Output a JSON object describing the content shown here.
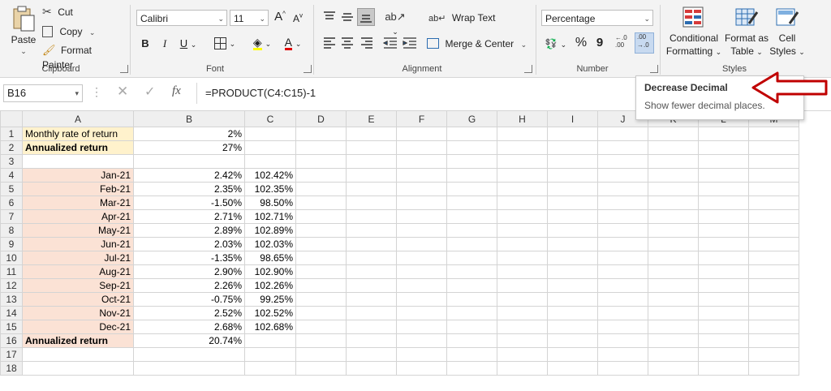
{
  "ribbon": {
    "clipboard": {
      "paste": "Paste",
      "cut": "Cut",
      "copy": "Copy",
      "format_painter": "Format Painter",
      "label": "Clipboard"
    },
    "font": {
      "name": "Calibri",
      "size": "11",
      "grow": "A",
      "shrink": "A",
      "bold": "B",
      "italic": "I",
      "underline": "U",
      "font_color": "A",
      "label": "Font"
    },
    "alignment": {
      "wrap_text": "Wrap Text",
      "merge_center": "Merge & Center",
      "label": "Alignment"
    },
    "number": {
      "format": "Percentage",
      "percent": "%",
      "comma": "9",
      "increase_decimal": "←.0 .00",
      "decrease_decimal": ".00 →.0",
      "label": "Number"
    },
    "styles": {
      "conditional": "Conditional",
      "formatting": "Formatting",
      "format_as": "Format as",
      "table": "Table",
      "cell": "Cell",
      "styles_word": "Styles",
      "label": "Styles"
    }
  },
  "formula_bar": {
    "name_box": "B16",
    "fx": "fx",
    "formula": "=PRODUCT(C4:C15)-1"
  },
  "tooltip": {
    "title": "Decrease Decimal",
    "body": "Show fewer decimal places."
  },
  "columns": [
    "A",
    "B",
    "C",
    "D",
    "E",
    "F",
    "G",
    "H",
    "I",
    "J",
    "K",
    "L",
    "M"
  ],
  "rows": [
    {
      "n": "1",
      "a": "Monthly rate of return",
      "b": "2%",
      "c": ""
    },
    {
      "n": "2",
      "a": "Annualized return",
      "b": "27%",
      "c": ""
    },
    {
      "n": "3",
      "a": "",
      "b": "",
      "c": ""
    },
    {
      "n": "4",
      "a": "Jan-21",
      "b": "2.42%",
      "c": "102.42%"
    },
    {
      "n": "5",
      "a": "Feb-21",
      "b": "2.35%",
      "c": "102.35%"
    },
    {
      "n": "6",
      "a": "Mar-21",
      "b": "-1.50%",
      "c": "98.50%"
    },
    {
      "n": "7",
      "a": "Apr-21",
      "b": "2.71%",
      "c": "102.71%"
    },
    {
      "n": "8",
      "a": "May-21",
      "b": "2.89%",
      "c": "102.89%"
    },
    {
      "n": "9",
      "a": "Jun-21",
      "b": "2.03%",
      "c": "102.03%"
    },
    {
      "n": "10",
      "a": "Jul-21",
      "b": "-1.35%",
      "c": "98.65%"
    },
    {
      "n": "11",
      "a": "Aug-21",
      "b": "2.90%",
      "c": "102.90%"
    },
    {
      "n": "12",
      "a": "Sep-21",
      "b": "2.26%",
      "c": "102.26%"
    },
    {
      "n": "13",
      "a": "Oct-21",
      "b": "-0.75%",
      "c": "99.25%"
    },
    {
      "n": "14",
      "a": "Nov-21",
      "b": "2.52%",
      "c": "102.52%"
    },
    {
      "n": "15",
      "a": "Dec-21",
      "b": "2.68%",
      "c": "102.68%"
    },
    {
      "n": "16",
      "a": "Annualized return",
      "b": "20.74%",
      "c": ""
    },
    {
      "n": "17",
      "a": "",
      "b": "",
      "c": ""
    },
    {
      "n": "18",
      "a": "",
      "b": "",
      "c": ""
    }
  ],
  "colors": {
    "accent_green": "#217346",
    "arrow_red": "#c00000",
    "peach": "#fbe2d5",
    "yellow": "#fff2cc"
  }
}
